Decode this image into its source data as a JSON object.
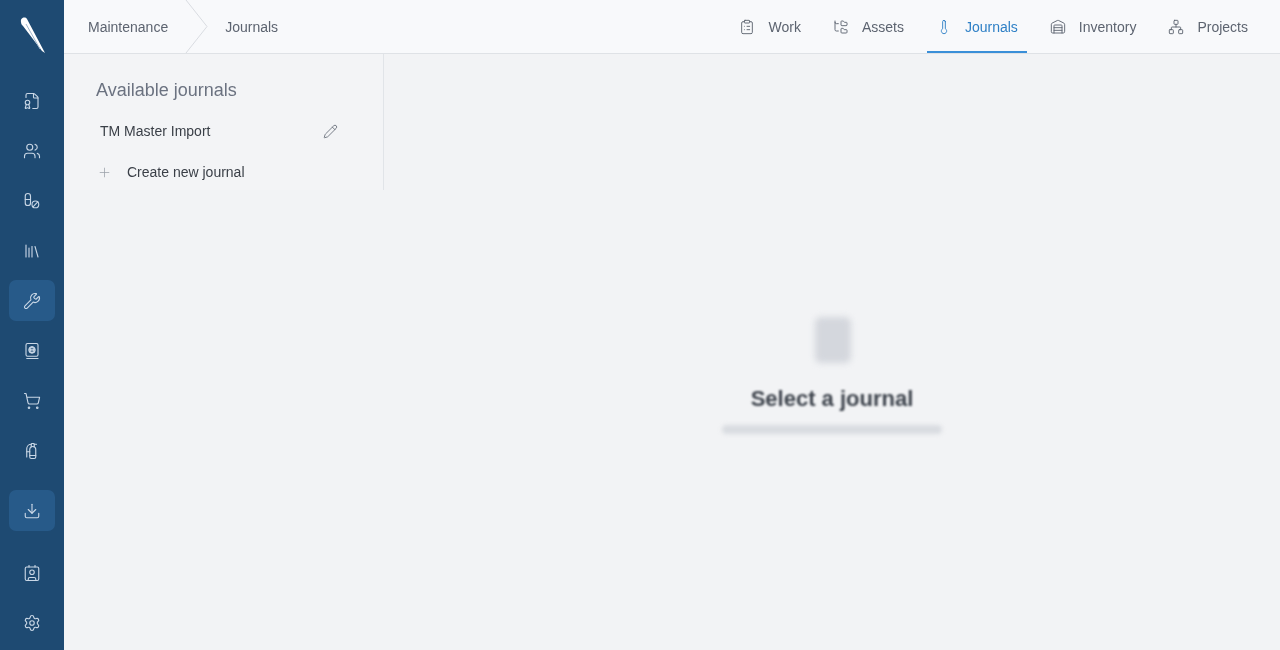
{
  "sidebar": {
    "main_items": [
      {
        "selected": false
      },
      {
        "selected": false
      },
      {
        "selected": false
      },
      {
        "selected": false
      },
      {
        "selected": true
      },
      {
        "selected": false
      },
      {
        "selected": false
      },
      {
        "selected": false
      }
    ],
    "tool_items": [
      {
        "selected": true
      }
    ],
    "footer_items": [
      {
        "selected": false
      },
      {
        "selected": false
      }
    ]
  },
  "breadcrumb": [
    "Maintenance",
    "Journals"
  ],
  "tabs": [
    {
      "label": "Work",
      "selected": false
    },
    {
      "label": "Assets",
      "selected": false
    },
    {
      "label": "Journals",
      "selected": true
    },
    {
      "label": "Inventory",
      "selected": false
    },
    {
      "label": "Projects",
      "selected": false
    }
  ],
  "journals_panel": {
    "title": "Available journals",
    "items": [
      {
        "label": "TM Master Import"
      }
    ],
    "create_label": "Create new journal"
  },
  "empty_state": {
    "title": "Select a journal"
  }
}
